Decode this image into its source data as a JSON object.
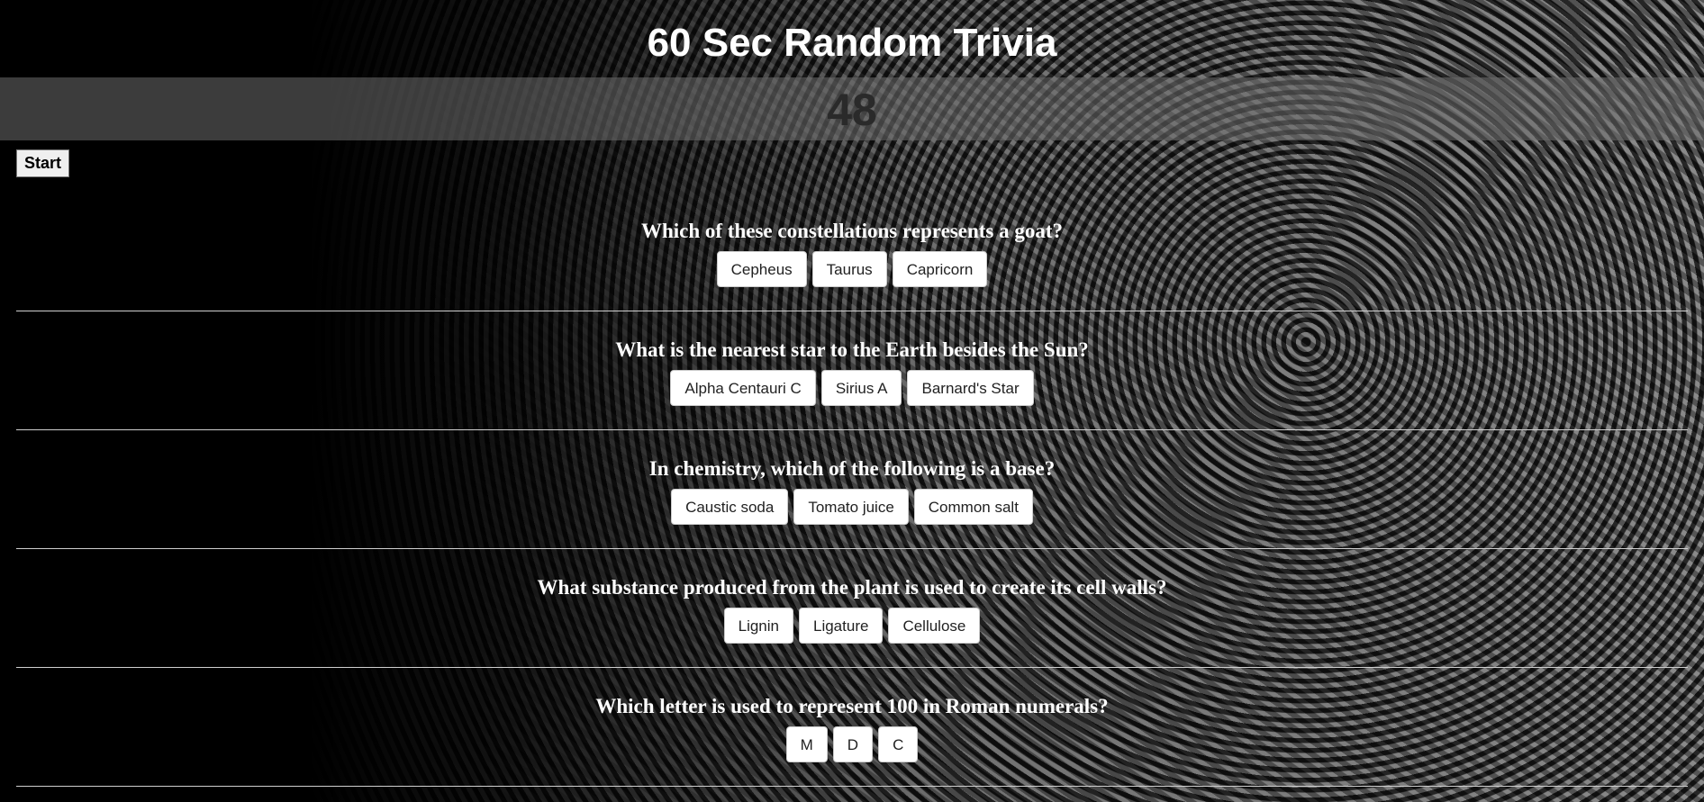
{
  "header": {
    "title": "60 Sec Random Trivia"
  },
  "timer": {
    "value": "48"
  },
  "controls": {
    "start_label": "Start"
  },
  "questions": [
    {
      "text": "Which of these constellations represents a goat?",
      "answers": [
        "Cepheus",
        "Taurus",
        "Capricorn"
      ]
    },
    {
      "text": "What is the nearest star to the Earth besides the Sun?",
      "answers": [
        "Alpha Centauri C",
        "Sirius A",
        "Barnard's Star"
      ]
    },
    {
      "text": "In chemistry, which of the following is a base?",
      "answers": [
        "Caustic soda",
        "Tomato juice",
        "Common salt"
      ]
    },
    {
      "text": "What substance produced from the plant is used to create its cell walls?",
      "answers": [
        "Lignin",
        "Ligature",
        "Cellulose"
      ]
    },
    {
      "text": "Which letter is used to represent 100 in Roman numerals?",
      "answers": [
        "M",
        "D",
        "C"
      ]
    }
  ]
}
